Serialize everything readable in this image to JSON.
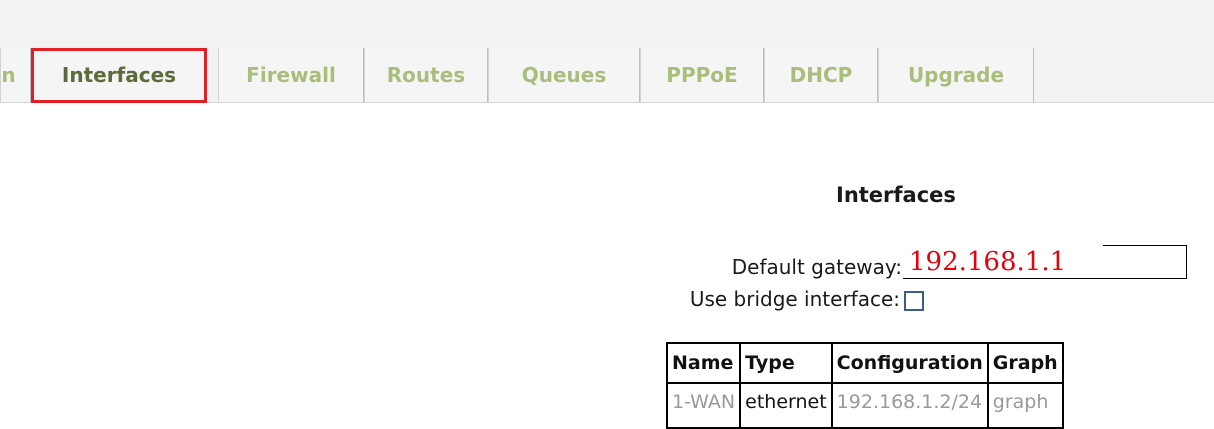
{
  "tabs": [
    {
      "label": "Interfaces",
      "active": true
    },
    {
      "label": "Firewall",
      "active": false
    },
    {
      "label": "Routes",
      "active": false
    },
    {
      "label": "Queues",
      "active": false
    },
    {
      "label": "PPPoE",
      "active": false
    },
    {
      "label": "DHCP",
      "active": false
    },
    {
      "label": "Upgrade",
      "active": false
    }
  ],
  "partial_tab_label": "n",
  "main": {
    "title": "Interfaces",
    "default_gateway_label": "Default gateway:",
    "default_gateway_value": "192.168.1.1",
    "bridge_label": "Use bridge interface:",
    "bridge_checked": false
  },
  "table": {
    "headers": [
      "Name",
      "Type",
      "Configuration",
      "Graph"
    ],
    "rows": [
      [
        "1-WAN",
        "ethernet",
        "192.168.1.2/24",
        "graph"
      ]
    ]
  },
  "colors": {
    "tab_text": "#a9be7b",
    "tab_active_text": "#5c6b3a",
    "highlight": "#e21f26",
    "gateway_value": "#e3000f"
  }
}
